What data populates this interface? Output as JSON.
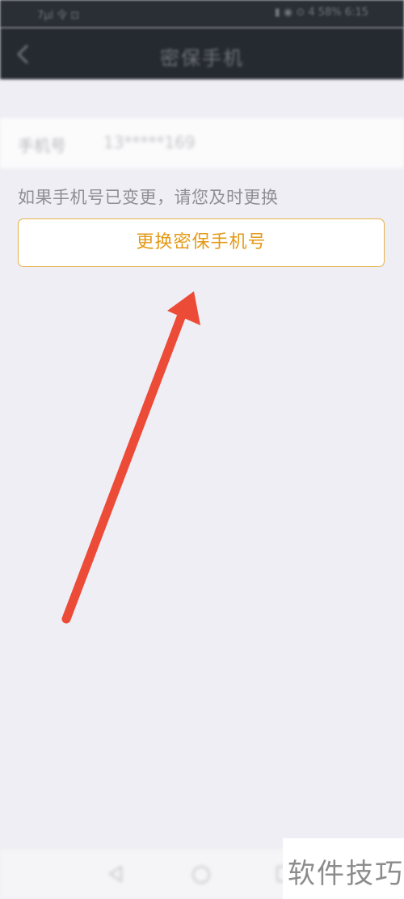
{
  "status_bar": {
    "left_text": "7µl 令 ⊡",
    "right_text": "▮ ◉ ⊙ 4 58% 6:15"
  },
  "header": {
    "title": "密保手机",
    "back_icon": "chevron-left-icon"
  },
  "phone_row": {
    "label": "手机号",
    "value": "13*****169"
  },
  "hint": "如果手机号已变更，请您及时更换",
  "change_button": {
    "label": "更换密保手机号",
    "color": "#e49a17",
    "border_color": "#e6b24a"
  },
  "annotation": {
    "arrow_color": "#ec4b37"
  },
  "bottom_nav": {
    "back": "triangle-back-icon",
    "home": "circle-home-icon",
    "recent": "square-recent-icon"
  },
  "watermark": {
    "text": "软件技巧"
  }
}
